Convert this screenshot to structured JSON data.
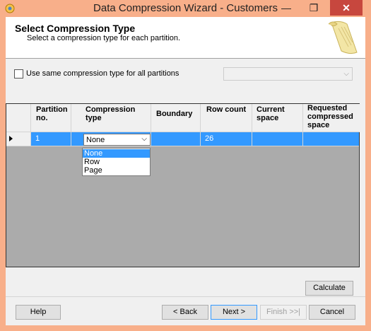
{
  "window": {
    "title": "Data Compression Wizard - Customers",
    "min_glyph": "—",
    "max_glyph": "❐",
    "close_glyph": "✕"
  },
  "header": {
    "title": "Select Compression Type",
    "subtitle": "Select a compression type for each partition."
  },
  "options": {
    "same_type_label": "Use same compression type for all partitions",
    "same_type_checked": false
  },
  "grid": {
    "columns": [
      {
        "label": "Partition no."
      },
      {
        "label": "Compression type"
      },
      {
        "label": "Boundary"
      },
      {
        "label": "Row count"
      },
      {
        "label": "Current space"
      },
      {
        "label": "Requested compressed space"
      }
    ],
    "rows": [
      {
        "partition": "1",
        "compression": "None",
        "boundary": "",
        "row_count": "26",
        "current": "",
        "requested": ""
      }
    ],
    "dropdown_options": [
      "None",
      "Row",
      "Page"
    ],
    "dropdown_selected": "None"
  },
  "buttons": {
    "calculate": "Calculate",
    "help": "Help",
    "back": "< Back",
    "next": "Next >",
    "finish": "Finish >>|",
    "cancel": "Cancel"
  },
  "colors": {
    "titlebar": "#f8af8a",
    "selection": "#3399ff",
    "close": "#c7473e"
  }
}
